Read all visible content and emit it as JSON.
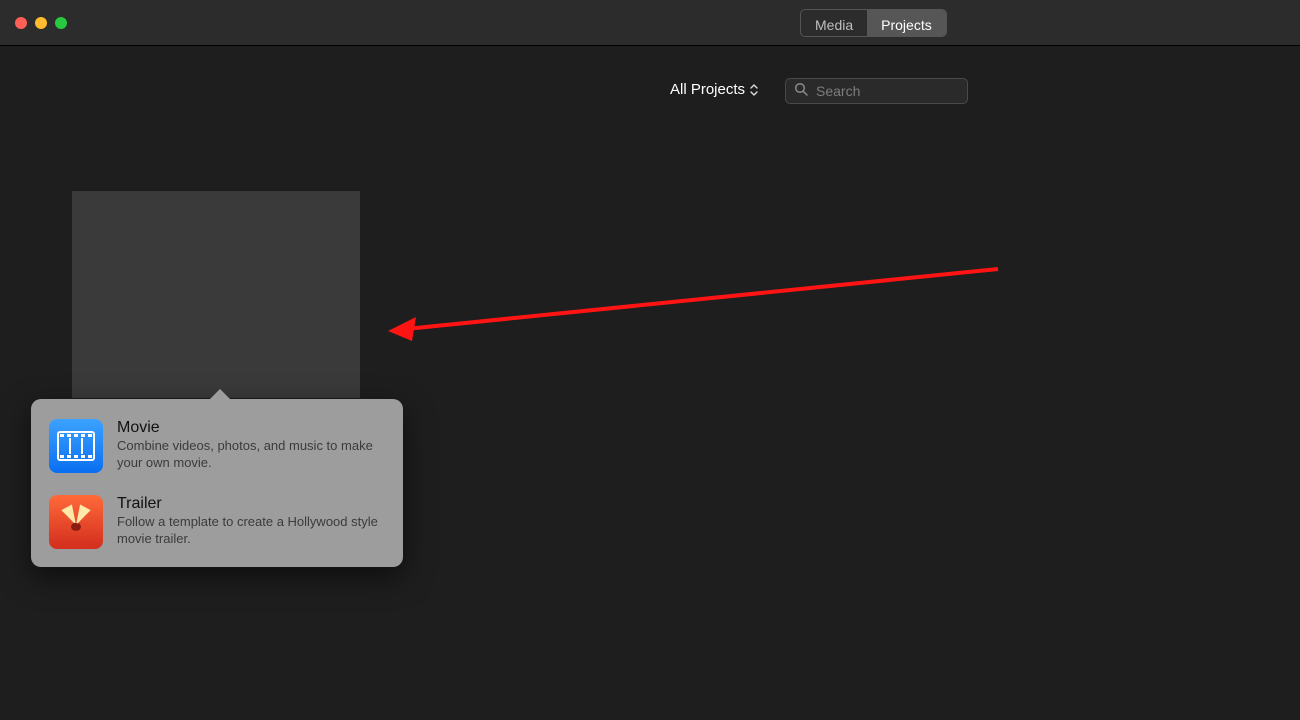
{
  "titlebar": {
    "segments": {
      "media": "Media",
      "projects": "Projects"
    }
  },
  "subbar": {
    "filter_label": "All Projects",
    "search_placeholder": "Search"
  },
  "popover": {
    "movie": {
      "title": "Movie",
      "desc": "Combine videos, photos, and music to make your own movie."
    },
    "trailer": {
      "title": "Trailer",
      "desc": "Follow a template to create a Hollywood style movie trailer."
    }
  }
}
